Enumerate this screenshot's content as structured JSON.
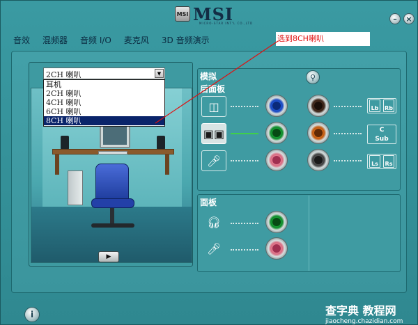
{
  "window": {
    "logo_text": "MSI",
    "logo_emblem": "MSI",
    "logo_sub": "MICRO-STAR INT'L CO.,LTD",
    "minimize_icon": "minimize-icon",
    "close_icon": "close-icon"
  },
  "tabs": [
    {
      "label": "音效"
    },
    {
      "label": "混频器"
    },
    {
      "label": "音频 I/O"
    },
    {
      "label": "麦克风"
    },
    {
      "label": "3D 音频演示"
    }
  ],
  "annotation": {
    "text": "选到8CH喇叭",
    "color": "#e01010"
  },
  "speaker_config": {
    "selected": "2CH 喇叭",
    "options": [
      "耳机",
      "2CH 喇叭",
      "4CH 喇叭",
      "6CH 喇叭",
      "8CH 喇叭"
    ],
    "highlighted": "8CH 喇叭"
  },
  "play_button_icon": "play-icon",
  "analog": {
    "title": "模拟",
    "rear_panel_label": "后面板",
    "hint_icon": "connector-settings-icon",
    "jacks_left": [
      {
        "color": "blue",
        "c1": "#1848c0",
        "c2": "#3a78ff",
        "c3": "#0a2a7a",
        "device": "line-in-icon",
        "active": false
      },
      {
        "color": "green",
        "c1": "#0e8a2a",
        "c2": "#2ed050",
        "c3": "#064a14",
        "device": "speaker-icon",
        "active": true
      },
      {
        "color": "pink",
        "c1": "#d86a80",
        "c2": "#ffb0c0",
        "c3": "#a03050",
        "device": "microphone-icon",
        "active": false
      }
    ],
    "jacks_right": [
      {
        "color": "black",
        "c1": "#3a2418",
        "c2": "#6a4430",
        "c3": "#1a0e08",
        "device": "rear-speakers-icon",
        "label_l": "Lb",
        "label_r": "Rb"
      },
      {
        "color": "orange",
        "c1": "#c05a10",
        "c2": "#ff9a40",
        "c3": "#602a06",
        "device": "center-sub-icon",
        "label_l": "C",
        "label_r": "Sub"
      },
      {
        "color": "gray",
        "c1": "#404040",
        "c2": "#7a7a7a",
        "c3": "#1a1a1a",
        "device": "side-speakers-icon",
        "label_l": "Ls",
        "label_r": "Rs"
      }
    ]
  },
  "front_panel": {
    "title": "面板",
    "jacks": [
      {
        "color": "green",
        "c1": "#0e8a2a",
        "c2": "#2ed050",
        "c3": "#064a14",
        "device": "headphone-icon"
      },
      {
        "color": "pink",
        "c1": "#d86a80",
        "c2": "#ffb0c0",
        "c3": "#a03050",
        "device": "microphone-icon"
      }
    ]
  },
  "footer": {
    "info_label": "i",
    "watermark_top": "查字典 教程网",
    "watermark_bottom": "jiaocheng.chazidian.com"
  }
}
